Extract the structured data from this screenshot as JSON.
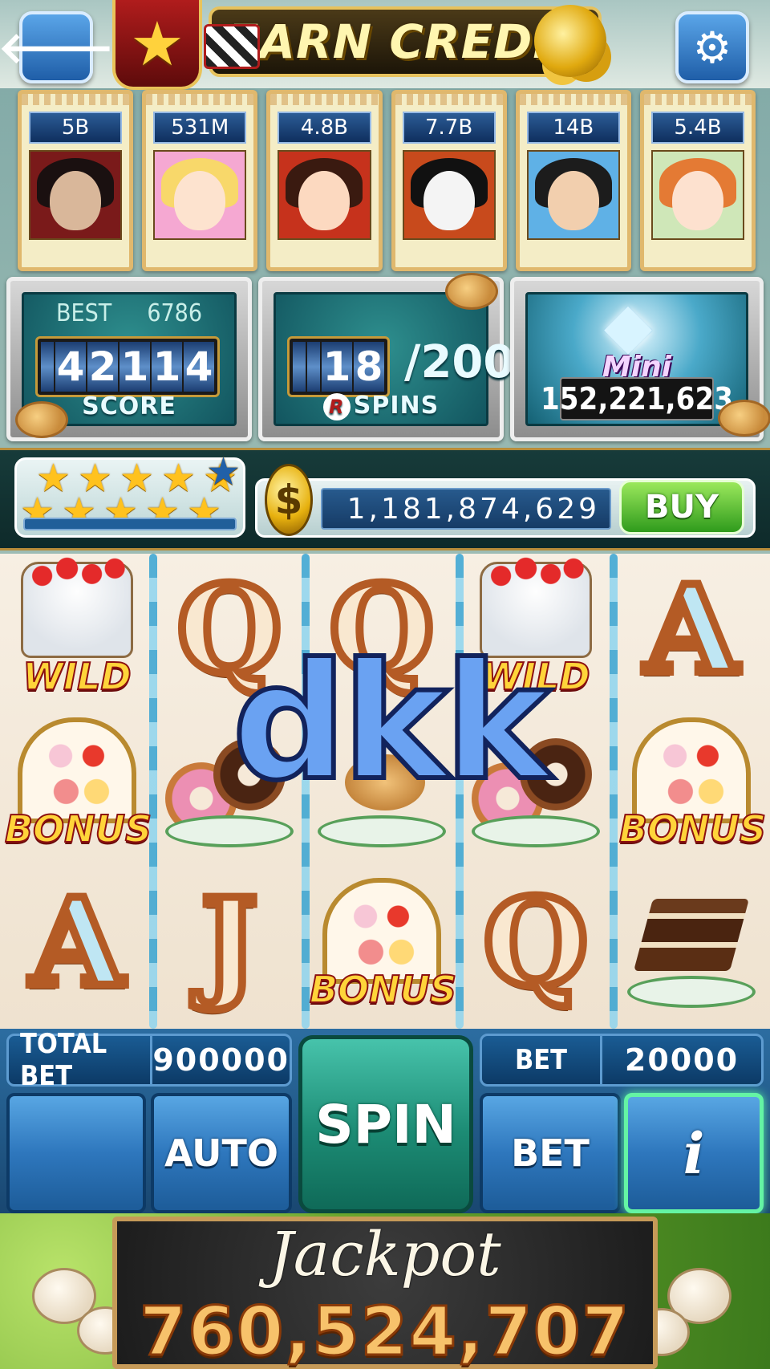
{
  "header": {
    "back_label": "back",
    "earn_credit": "EARN CREDIT",
    "settings_label": "settings"
  },
  "players": [
    {
      "credit": "5B",
      "avatar": "vampire-avatar"
    },
    {
      "credit": "531M",
      "avatar": "blonde-girl-avatar"
    },
    {
      "credit": "4.8B",
      "avatar": "red-dancer-avatar"
    },
    {
      "credit": "7.7B",
      "avatar": "panda-avatar"
    },
    {
      "credit": "14B",
      "avatar": "cap-boy-avatar"
    },
    {
      "credit": "5.4B",
      "avatar": "redhead-girl-avatar"
    }
  ],
  "score_panel": {
    "best_label": "BEST",
    "best_value": "6786",
    "score_digits": [
      "4",
      "2",
      "1",
      "1",
      "4"
    ],
    "label": "SCORE"
  },
  "spins_panel": {
    "current_digits": [
      "1",
      "8"
    ],
    "total": "/200",
    "logo": "R",
    "label": "SPINS"
  },
  "mini_jackpot": {
    "title": "Mini JACKPOT",
    "value": "152,221,623"
  },
  "level": {
    "stars_filled": 10,
    "stars_total": 11,
    "xp_fraction": 0.0
  },
  "credits": {
    "symbol": "$",
    "value": "1,181,874,629",
    "buy_label": "BUY"
  },
  "reels": {
    "columns": [
      [
        "wild-cake",
        "tea-stand",
        "letter-A"
      ],
      [
        "letter-Q",
        "donuts",
        "letter-J"
      ],
      [
        "letter-Q",
        "pancakes",
        "tea-stand"
      ],
      [
        "wild-cake",
        "donuts",
        "letter-Q"
      ],
      [
        "letter-A",
        "tea-stand",
        "cake-slice"
      ]
    ],
    "wild_label": "WILD",
    "bonus_label": "BONUS",
    "letters": {
      "A": "A",
      "Q": "Q",
      "J": "J"
    }
  },
  "overlay_text": "dkk",
  "controls": {
    "total_bet_label": "TOTAL BET",
    "total_bet_value": "900000",
    "bet_label": "BET",
    "bet_value": "20000",
    "auto_label": "AUTO",
    "spin_label": "SPIN",
    "bet_button_label": "BET",
    "info_label": "i"
  },
  "jackpot": {
    "label": "Jackpot",
    "value": "760,524,707"
  },
  "colors": {
    "accent_gold": "#e6c25e",
    "button_blue": "#2e77bd",
    "spin_green": "#1c8b74",
    "buy_green": "#2f9b1c"
  }
}
